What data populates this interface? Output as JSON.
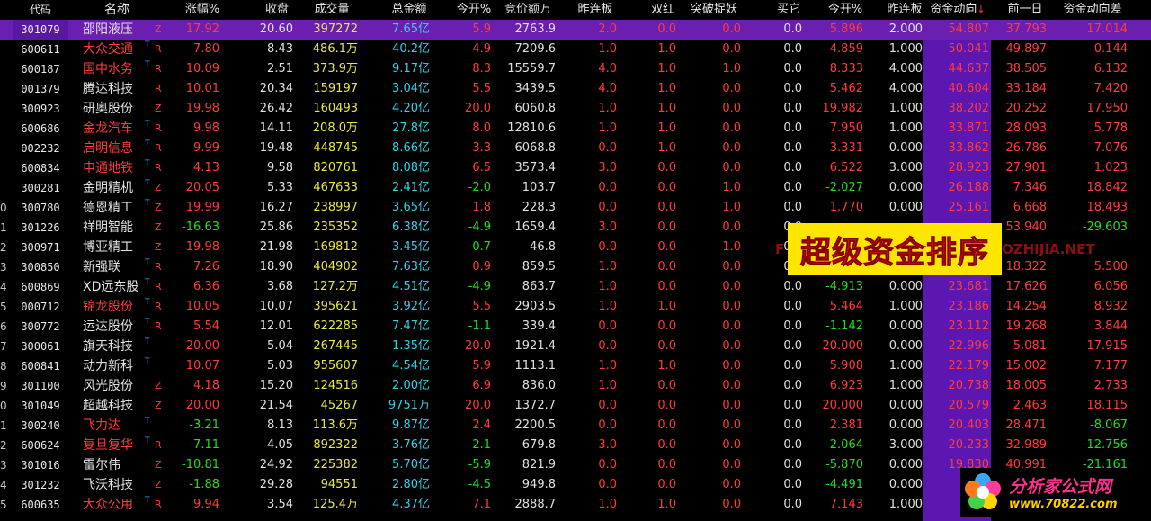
{
  "columns": {
    "code": "代码",
    "name": "名称",
    "chg": "涨幅%",
    "close": "收盘",
    "vol": "成交量",
    "amt": "总金额",
    "open": "今开%",
    "bid": "竞价额万",
    "ylb": "昨连板",
    "dr": "双红",
    "brk": "突破捉妖",
    "buy": "买它",
    "op2": "今开%",
    "ylb2": "昨连板",
    "flow": "资金动向",
    "flow_sort": "↓",
    "prev": "前一日",
    "diff": "资金动向差"
  },
  "banner": "超级资金排序",
  "watermark_left": "F",
  "watermark_right": "OZHIJIA.NET",
  "logo": {
    "line1": "分析家公式网",
    "line2": "www.70822.com"
  },
  "rows": [
    {
      "idx": "",
      "code": "301079",
      "name": "邵阳液压",
      "flag": "",
      "tag": "Z",
      "chg": "17.92",
      "close": "20.60",
      "vol": "397272",
      "amt": "7.65亿",
      "open": "5.9",
      "bid": "2763.9",
      "ylb": "2.0",
      "dr": "0.0",
      "brk": "0.0",
      "buy": "0.0",
      "op2": "5.896",
      "ylb2": "2.000",
      "flow": "54.807",
      "prev": "37.793",
      "diff": "17.014",
      "name_color": "white",
      "chg_color": "red",
      "open_color": "red",
      "op2_color": "red",
      "diff_color": "red",
      "selected": true
    },
    {
      "idx": "",
      "code": "600611",
      "name": "大众交通",
      "flag": "T",
      "tag": "R",
      "chg": "7.80",
      "close": "8.43",
      "vol": "486.1万",
      "amt": "40.2亿",
      "open": "4.9",
      "bid": "7209.6",
      "ylb": "1.0",
      "dr": "1.0",
      "brk": "0.0",
      "buy": "0.0",
      "op2": "4.859",
      "ylb2": "1.000",
      "flow": "50.041",
      "prev": "49.897",
      "diff": "0.144",
      "name_color": "red",
      "chg_color": "red",
      "open_color": "red",
      "op2_color": "red",
      "diff_color": "red"
    },
    {
      "idx": "",
      "code": "600187",
      "name": "国中水务",
      "flag": "T",
      "tag": "R",
      "chg": "10.09",
      "close": "2.51",
      "vol": "373.9万",
      "amt": "9.17亿",
      "open": "8.3",
      "bid": "15559.7",
      "ylb": "4.0",
      "dr": "1.0",
      "brk": "1.0",
      "buy": "0.0",
      "op2": "8.333",
      "ylb2": "4.000",
      "flow": "44.637",
      "prev": "38.505",
      "diff": "6.132",
      "name_color": "red",
      "chg_color": "red",
      "open_color": "red",
      "op2_color": "red",
      "diff_color": "red"
    },
    {
      "idx": "",
      "code": "001379",
      "name": "腾达科技",
      "flag": "",
      "tag": "R",
      "chg": "10.01",
      "close": "20.34",
      "vol": "159197",
      "amt": "3.04亿",
      "open": "5.5",
      "bid": "3439.5",
      "ylb": "4.0",
      "dr": "1.0",
      "brk": "0.0",
      "buy": "0.0",
      "op2": "5.462",
      "ylb2": "4.000",
      "flow": "40.604",
      "prev": "33.184",
      "diff": "7.420",
      "name_color": "white",
      "chg_color": "red",
      "open_color": "red",
      "op2_color": "red",
      "diff_color": "red"
    },
    {
      "idx": "",
      "code": "300923",
      "name": "研奥股份",
      "flag": "",
      "tag": "Z",
      "chg": "19.98",
      "close": "26.42",
      "vol": "160493",
      "amt": "4.20亿",
      "open": "20.0",
      "bid": "6060.8",
      "ylb": "1.0",
      "dr": "1.0",
      "brk": "0.0",
      "buy": "0.0",
      "op2": "19.982",
      "ylb2": "1.000",
      "flow": "38.202",
      "prev": "20.252",
      "diff": "17.950",
      "name_color": "white",
      "chg_color": "red",
      "open_color": "red",
      "op2_color": "red",
      "diff_color": "red"
    },
    {
      "idx": "",
      "code": "600686",
      "name": "金龙汽车",
      "flag": "T",
      "tag": "R",
      "chg": "9.98",
      "close": "14.11",
      "vol": "208.0万",
      "amt": "27.8亿",
      "open": "8.0",
      "bid": "12810.6",
      "ylb": "1.0",
      "dr": "1.0",
      "brk": "0.0",
      "buy": "0.0",
      "op2": "7.950",
      "ylb2": "1.000",
      "flow": "33.871",
      "prev": "28.093",
      "diff": "5.778",
      "name_color": "red",
      "chg_color": "red",
      "open_color": "red",
      "op2_color": "red",
      "diff_color": "red"
    },
    {
      "idx": "",
      "code": "002232",
      "name": "启明信息",
      "flag": "T",
      "tag": "R",
      "chg": "9.99",
      "close": "19.48",
      "vol": "448745",
      "amt": "8.66亿",
      "open": "3.3",
      "bid": "6068.8",
      "ylb": "0.0",
      "dr": "1.0",
      "brk": "0.0",
      "buy": "0.0",
      "op2": "3.331",
      "ylb2": "0.000",
      "flow": "33.862",
      "prev": "26.786",
      "diff": "7.076",
      "name_color": "red",
      "chg_color": "red",
      "open_color": "red",
      "op2_color": "red",
      "diff_color": "red"
    },
    {
      "idx": "",
      "code": "600834",
      "name": "申通地铁",
      "flag": "T",
      "tag": "R",
      "chg": "4.13",
      "close": "9.58",
      "vol": "820761",
      "amt": "8.08亿",
      "open": "6.5",
      "bid": "3573.4",
      "ylb": "3.0",
      "dr": "0.0",
      "brk": "0.0",
      "buy": "0.0",
      "op2": "6.522",
      "ylb2": "3.000",
      "flow": "28.923",
      "prev": "27.901",
      "diff": "1.023",
      "name_color": "red",
      "chg_color": "red",
      "open_color": "red",
      "op2_color": "red",
      "diff_color": "red"
    },
    {
      "idx": "",
      "code": "300281",
      "name": "金明精机",
      "flag": "T",
      "tag": "Z",
      "chg": "20.05",
      "close": "5.33",
      "vol": "467633",
      "amt": "2.41亿",
      "open": "-2.0",
      "bid": "103.7",
      "ylb": "0.0",
      "dr": "0.0",
      "brk": "1.0",
      "buy": "0.0",
      "op2": "-2.027",
      "ylb2": "0.000",
      "flow": "26.188",
      "prev": "7.346",
      "diff": "18.842",
      "name_color": "white",
      "chg_color": "red",
      "open_color": "green",
      "op2_color": "green",
      "diff_color": "red"
    },
    {
      "idx": "0",
      "code": "300780",
      "name": "德恩精工",
      "flag": "T",
      "tag": "Z",
      "chg": "19.99",
      "close": "16.27",
      "vol": "238997",
      "amt": "3.65亿",
      "open": "1.8",
      "bid": "228.3",
      "ylb": "0.0",
      "dr": "0.0",
      "brk": "1.0",
      "buy": "0.0",
      "op2": "1.770",
      "ylb2": "0.000",
      "flow": "25.161",
      "prev": "6.668",
      "diff": "18.493",
      "name_color": "white",
      "chg_color": "red",
      "open_color": "red",
      "op2_color": "red",
      "diff_color": "red"
    },
    {
      "idx": "1",
      "code": "301226",
      "name": "祥明智能",
      "flag": "",
      "tag": "Z",
      "chg": "-16.63",
      "close": "25.86",
      "vol": "235352",
      "amt": "6.38亿",
      "open": "-4.9",
      "bid": "1659.4",
      "ylb": "3.0",
      "dr": "0.0",
      "brk": "0.0",
      "buy": "0.0",
      "op2": "",
      "ylb2": "",
      "flow": "",
      "prev": "53.940",
      "diff": "-29.603",
      "name_color": "white",
      "chg_color": "green",
      "open_color": "green",
      "op2_color": "green",
      "diff_color": "green"
    },
    {
      "idx": "2",
      "code": "300971",
      "name": "博亚精工",
      "flag": "",
      "tag": "Z",
      "chg": "19.98",
      "close": "21.98",
      "vol": "169812",
      "amt": "3.45亿",
      "open": "-0.7",
      "bid": "46.8",
      "ylb": "0.0",
      "dr": "0.0",
      "brk": "1.0",
      "buy": "0.0",
      "op2": "",
      "ylb2": "",
      "flow": "",
      "prev": "",
      "diff": "",
      "name_color": "white",
      "chg_color": "red",
      "open_color": "green",
      "op2_color": "green",
      "diff_color": "red"
    },
    {
      "idx": "3",
      "code": "300850",
      "name": "新强联",
      "flag": "T",
      "tag": "R",
      "chg": "7.26",
      "close": "18.90",
      "vol": "404902",
      "amt": "7.63亿",
      "open": "0.9",
      "bid": "859.5",
      "ylb": "1.0",
      "dr": "0.0",
      "brk": "0.0",
      "buy": "0.0",
      "op2": "",
      "ylb2": "",
      "flow": "",
      "prev": "18.322",
      "diff": "5.500",
      "name_color": "white",
      "chg_color": "red",
      "open_color": "red",
      "op2_color": "red",
      "diff_color": "red"
    },
    {
      "idx": "4",
      "code": "600869",
      "name": "XD远东股",
      "flag": "T",
      "tag": "R",
      "chg": "6.36",
      "close": "3.68",
      "vol": "127.2万",
      "amt": "4.51亿",
      "open": "-4.9",
      "bid": "863.7",
      "ylb": "1.0",
      "dr": "0.0",
      "brk": "0.0",
      "buy": "0.0",
      "op2": "-4.913",
      "ylb2": "0.000",
      "flow": "23.681",
      "prev": "17.626",
      "diff": "6.056",
      "name_color": "white",
      "chg_color": "red",
      "open_color": "green",
      "op2_color": "green",
      "diff_color": "red"
    },
    {
      "idx": "5",
      "code": "000712",
      "name": "锦龙股份",
      "flag": "T",
      "tag": "R",
      "chg": "10.05",
      "close": "10.07",
      "vol": "395621",
      "amt": "3.92亿",
      "open": "5.5",
      "bid": "2903.5",
      "ylb": "1.0",
      "dr": "1.0",
      "brk": "0.0",
      "buy": "0.0",
      "op2": "5.464",
      "ylb2": "1.000",
      "flow": "23.186",
      "prev": "14.254",
      "diff": "8.932",
      "name_color": "red",
      "chg_color": "red",
      "open_color": "red",
      "op2_color": "red",
      "diff_color": "red"
    },
    {
      "idx": "6",
      "code": "300772",
      "name": "运达股份",
      "flag": "T",
      "tag": "R",
      "chg": "5.54",
      "close": "12.01",
      "vol": "622285",
      "amt": "7.47亿",
      "open": "-1.1",
      "bid": "339.4",
      "ylb": "0.0",
      "dr": "0.0",
      "brk": "0.0",
      "buy": "0.0",
      "op2": "-1.142",
      "ylb2": "0.000",
      "flow": "23.112",
      "prev": "19.268",
      "diff": "3.844",
      "name_color": "white",
      "chg_color": "red",
      "open_color": "green",
      "op2_color": "green",
      "diff_color": "red"
    },
    {
      "idx": "7",
      "code": "300061",
      "name": "旗天科技",
      "flag": "T",
      "tag": "",
      "chg": "20.00",
      "close": "5.04",
      "vol": "267445",
      "amt": "1.35亿",
      "open": "20.0",
      "bid": "1921.4",
      "ylb": "0.0",
      "dr": "0.0",
      "brk": "0.0",
      "buy": "0.0",
      "op2": "20.000",
      "ylb2": "0.000",
      "flow": "22.996",
      "prev": "5.081",
      "diff": "17.915",
      "name_color": "white",
      "chg_color": "red",
      "open_color": "red",
      "op2_color": "red",
      "diff_color": "red"
    },
    {
      "idx": "8",
      "code": "600841",
      "name": "动力新科",
      "flag": "T",
      "tag": "",
      "chg": "10.07",
      "close": "5.03",
      "vol": "955607",
      "amt": "4.54亿",
      "open": "5.9",
      "bid": "1113.1",
      "ylb": "1.0",
      "dr": "1.0",
      "brk": "0.0",
      "buy": "0.0",
      "op2": "5.908",
      "ylb2": "1.000",
      "flow": "22.179",
      "prev": "15.002",
      "diff": "7.177",
      "name_color": "white",
      "chg_color": "red",
      "open_color": "red",
      "op2_color": "red",
      "diff_color": "red"
    },
    {
      "idx": "9",
      "code": "301100",
      "name": "风光股份",
      "flag": "",
      "tag": "Z",
      "chg": "4.18",
      "close": "15.20",
      "vol": "124516",
      "amt": "2.00亿",
      "open": "6.9",
      "bid": "836.0",
      "ylb": "1.0",
      "dr": "0.0",
      "brk": "0.0",
      "buy": "0.0",
      "op2": "6.923",
      "ylb2": "1.000",
      "flow": "20.738",
      "prev": "18.005",
      "diff": "2.733",
      "name_color": "white",
      "chg_color": "red",
      "open_color": "red",
      "op2_color": "red",
      "diff_color": "red"
    },
    {
      "idx": "0",
      "code": "301049",
      "name": "超越科技",
      "flag": "",
      "tag": "Z",
      "chg": "20.00",
      "close": "21.54",
      "vol": "45267",
      "amt": "9751万",
      "open": "20.0",
      "bid": "1372.7",
      "ylb": "0.0",
      "dr": "0.0",
      "brk": "0.0",
      "buy": "0.0",
      "op2": "20.000",
      "ylb2": "0.000",
      "flow": "20.579",
      "prev": "2.463",
      "diff": "18.115",
      "name_color": "white",
      "chg_color": "red",
      "open_color": "red",
      "op2_color": "red",
      "diff_color": "red"
    },
    {
      "idx": "1",
      "code": "300240",
      "name": "飞力达",
      "flag": "T",
      "tag": "",
      "chg": "-3.21",
      "close": "8.13",
      "vol": "113.6万",
      "amt": "9.87亿",
      "open": "2.4",
      "bid": "2200.5",
      "ylb": "0.0",
      "dr": "0.0",
      "brk": "0.0",
      "buy": "0.0",
      "op2": "2.381",
      "ylb2": "0.000",
      "flow": "20.403",
      "prev": "28.471",
      "diff": "-8.067",
      "name_color": "red",
      "chg_color": "green",
      "open_color": "red",
      "op2_color": "red",
      "diff_color": "green"
    },
    {
      "idx": "2",
      "code": "600624",
      "name": "复旦复华",
      "flag": "T",
      "tag": "R",
      "chg": "-7.11",
      "close": "4.05",
      "vol": "892322",
      "amt": "3.76亿",
      "open": "-2.1",
      "bid": "679.8",
      "ylb": "3.0",
      "dr": "0.0",
      "brk": "0.0",
      "buy": "0.0",
      "op2": "-2.064",
      "ylb2": "3.000",
      "flow": "20.233",
      "prev": "32.989",
      "diff": "-12.756",
      "name_color": "red",
      "chg_color": "green",
      "open_color": "green",
      "op2_color": "green",
      "diff_color": "green"
    },
    {
      "idx": "3",
      "code": "301016",
      "name": "雷尔伟",
      "flag": "",
      "tag": "Z",
      "chg": "-10.81",
      "close": "24.92",
      "vol": "225382",
      "amt": "5.70亿",
      "open": "-5.9",
      "bid": "821.9",
      "ylb": "0.0",
      "dr": "0.0",
      "brk": "0.0",
      "buy": "0.0",
      "op2": "-5.870",
      "ylb2": "0.000",
      "flow": "19.830",
      "prev": "40.991",
      "diff": "-21.161",
      "name_color": "white",
      "chg_color": "green",
      "open_color": "green",
      "op2_color": "green",
      "diff_color": "green"
    },
    {
      "idx": "4",
      "code": "301232",
      "name": "飞沃科技",
      "flag": "",
      "tag": "Z",
      "chg": "-1.88",
      "close": "29.28",
      "vol": "94551",
      "amt": "2.80亿",
      "open": "-4.5",
      "bid": "949.8",
      "ylb": "0.0",
      "dr": "0.0",
      "brk": "0.0",
      "buy": "0.0",
      "op2": "-4.491",
      "ylb2": "0.000",
      "flow": "19",
      "prev": "",
      "diff": "",
      "name_color": "white",
      "chg_color": "green",
      "open_color": "green",
      "op2_color": "green",
      "diff_color": "green"
    },
    {
      "idx": "5",
      "code": "600635",
      "name": "大众公用",
      "flag": "T",
      "tag": "R",
      "chg": "9.94",
      "close": "3.54",
      "vol": "125.4万",
      "amt": "4.37亿",
      "open": "7.1",
      "bid": "2888.7",
      "ylb": "1.0",
      "dr": "1.0",
      "brk": "0.0",
      "buy": "0.0",
      "op2": "7.143",
      "ylb2": "1.000",
      "flow": "19",
      "prev": "",
      "diff": "",
      "name_color": "red",
      "chg_color": "red",
      "open_color": "red",
      "op2_color": "red",
      "diff_color": "red"
    }
  ]
}
